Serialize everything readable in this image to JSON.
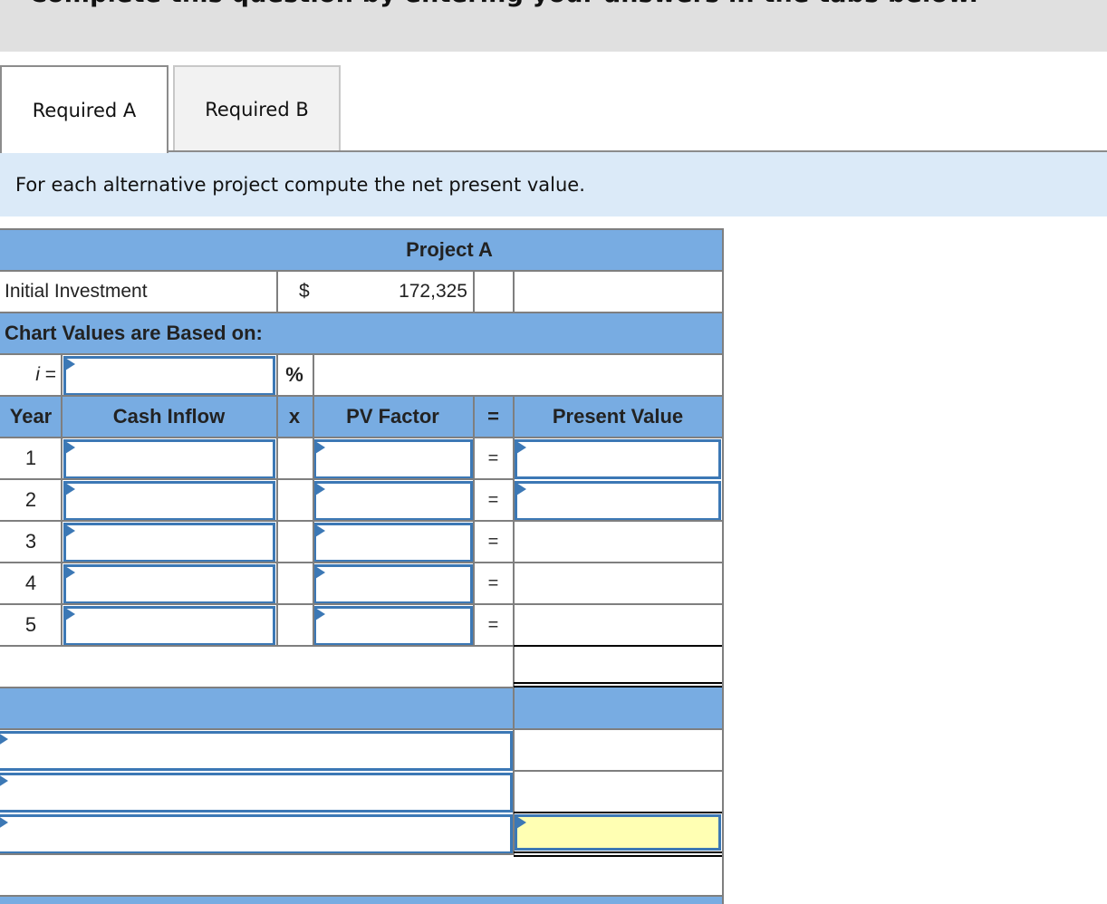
{
  "banner": {
    "title": "Complete this question by entering your answers in the tabs below."
  },
  "tabs": [
    {
      "label": "Required A",
      "active": true
    },
    {
      "label": "Required B",
      "active": false
    }
  ],
  "instruction": "For each alternative project compute the net present value.",
  "table": {
    "project_title": "Project A",
    "initial_investment": {
      "label": "Initial Investment",
      "currency": "$",
      "value": "172,325"
    },
    "chart_values_label": "Chart Values are Based on:",
    "rate": {
      "label": "i =",
      "value": "",
      "unit": "%"
    },
    "columns": {
      "year": "Year",
      "cash_inflow": "Cash Inflow",
      "times": "x",
      "pv_factor": "PV Factor",
      "equals": "=",
      "present_value": "Present Value"
    },
    "rows": [
      {
        "year": "1",
        "cash_inflow": "",
        "pv_factor": "",
        "equals": "=",
        "present_value": ""
      },
      {
        "year": "2",
        "cash_inflow": "",
        "pv_factor": "",
        "equals": "=",
        "present_value": ""
      },
      {
        "year": "3",
        "cash_inflow": "",
        "pv_factor": "",
        "equals": "=",
        "present_value": ""
      },
      {
        "year": "4",
        "cash_inflow": "",
        "pv_factor": "",
        "equals": "=",
        "present_value": ""
      },
      {
        "year": "5",
        "cash_inflow": "",
        "pv_factor": "",
        "equals": "=",
        "present_value": ""
      }
    ],
    "summary_rows": [
      {
        "label": "",
        "value": ""
      },
      {
        "label": "",
        "value": ""
      },
      {
        "label": "",
        "value": ""
      }
    ],
    "colors": {
      "header_blue": "#78ace2",
      "input_border": "#3c78b5",
      "highlight_yellow": "#ffffb3",
      "instruction_bg": "#dbeaf8"
    }
  }
}
